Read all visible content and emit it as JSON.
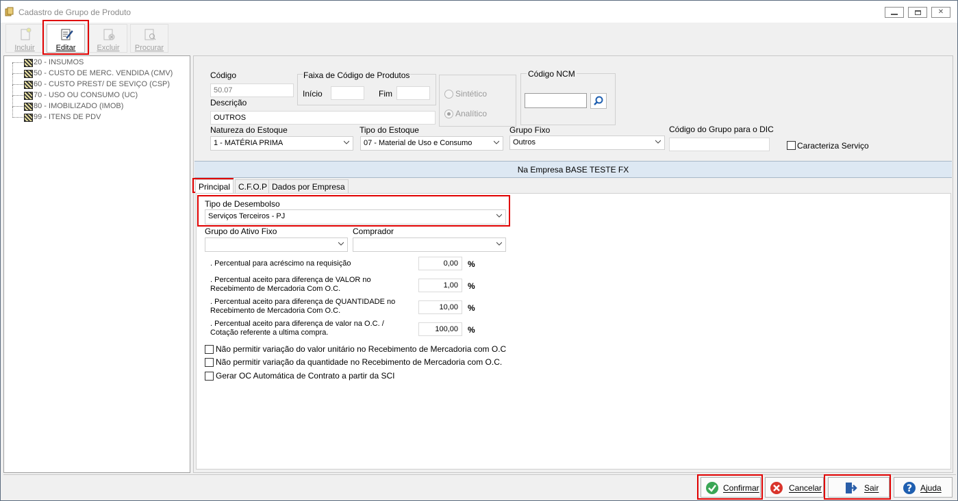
{
  "window": {
    "title": "Cadastro de Grupo de Produto",
    "controls": {
      "minimize": "▭",
      "restore": "⧉",
      "close": "✕"
    }
  },
  "toolbar": {
    "incluir": "Incluir",
    "editar": "Editar",
    "excluir": "Excluir",
    "procurar": "Procurar"
  },
  "tree": {
    "items": [
      "20 - INSUMOS",
      "50 - CUSTO DE MERC. VENDIDA (CMV)",
      "60 - CUSTO PREST/ DE SEVIÇO (CSP)",
      "70 - USO OU CONSUMO (UC)",
      "80 - IMOBILIZADO (IMOB)",
      "99 - ITENS DE PDV"
    ]
  },
  "form": {
    "codigo_label": "Código",
    "codigo_value": "50.07",
    "descricao_label": "Descrição",
    "descricao_value": "OUTROS",
    "faixa_label": "Faixa de Código de Produtos",
    "inicio_label": "Início",
    "inicio_value": "",
    "fim_label": "Fim",
    "fim_value": "",
    "sintetico_label": "Sintético",
    "analitico_label": "Analítico",
    "ncm_label": "Código NCM",
    "ncm_value": "",
    "natureza_label": "Natureza do Estoque",
    "natureza_value": "1 - MATÉRIA PRIMA",
    "tipo_estoque_label": "Tipo do Estoque",
    "tipo_estoque_value": "07 - Material de Uso e Consumo",
    "grupo_fixo_label": "Grupo Fixo",
    "grupo_fixo_value": "Outros",
    "codigo_dic_label": "Código do Grupo para o DIC",
    "codigo_dic_value": "",
    "caracteriza_servico_label": "Caracteriza Serviço"
  },
  "empresa_bar": "Na Empresa BASE TESTE FX",
  "tabs": [
    "Principal",
    "C.F.O.P",
    "Dados por Empresa"
  ],
  "principal": {
    "tipo_desembolso_label": "Tipo de Desembolso",
    "tipo_desembolso_value": "Serviços Terceiros - PJ",
    "grupo_ativo_label": "Grupo do Ativo Fixo",
    "grupo_ativo_value": "",
    "comprador_label": "Comprador",
    "comprador_value": "",
    "percentuais": [
      {
        "label_1": ". Percentual para acréscimo na requisição",
        "label_2": "",
        "value": "0,00"
      },
      {
        "label_1": ". Percentual aceito para diferença de VALOR no",
        "label_2": "Recebimento de Mercadoria Com O.C.",
        "value": "1,00"
      },
      {
        "label_1": ". Percentual aceito para diferença de QUANTIDADE no",
        "label_2": "Recebimento de Mercadoria Com O.C.",
        "value": "10,00"
      },
      {
        "label_1": ". Percentual aceito para diferença de valor na O.C. /",
        "label_2": "Cotação referente a ultima compra.",
        "value": "100,00"
      }
    ],
    "pct_sign": "%",
    "checkboxes": [
      "Não permitir variação do valor unitário no Recebimento de Mercadoria com O.C",
      "Não permitir variação da quantidade no Recebimento de Mercadoria com O.C.",
      "Gerar OC Automática de Contrato a partir da SCI"
    ]
  },
  "buttons": {
    "confirmar": "Confirmar",
    "cancelar": "Cancelar",
    "sair": "Sair",
    "ajuda": "Ajuda"
  },
  "colors": {
    "highlight_red": "#e00000",
    "empresa_bar_bg": "#dde8f3",
    "confirm_green": "#3aa655",
    "cancel_red": "#d9342b",
    "help_blue": "#1f5fb0"
  }
}
